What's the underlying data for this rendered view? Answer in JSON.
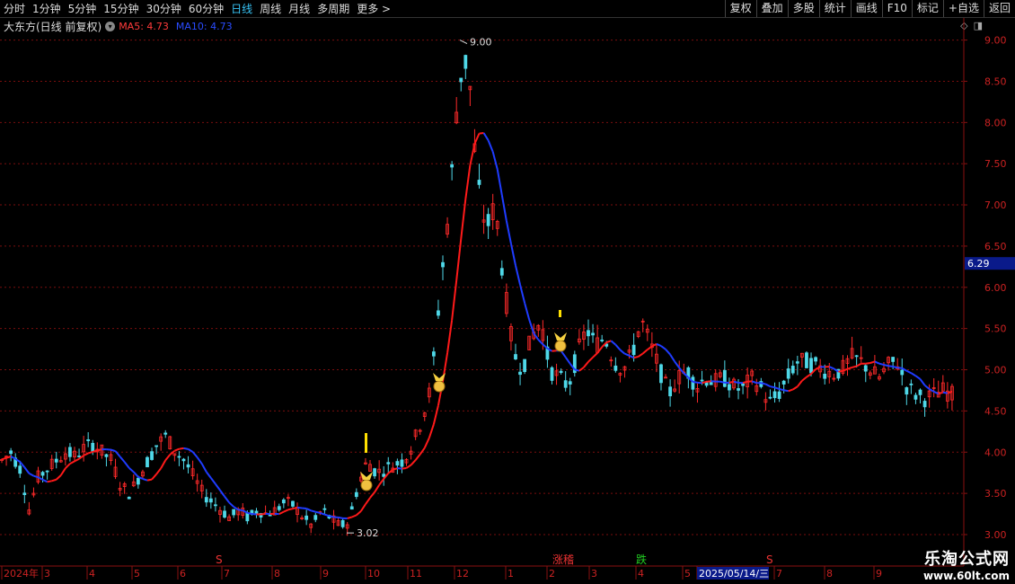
{
  "toolbar": {
    "left": [
      "分时",
      "1分钟",
      "5分钟",
      "15分钟",
      "30分钟",
      "60分钟",
      "日线",
      "周线",
      "月线",
      "多周期",
      "更多 >"
    ],
    "active_index": 6,
    "right": [
      "复权",
      "叠加",
      "多股",
      "统计",
      "画线",
      "F10",
      "标记",
      "+自选",
      "返回"
    ]
  },
  "title": {
    "stock": "大东方(日线 前复权)",
    "ma5": "MA5: 4.73",
    "ma10": "MA10: 4.73"
  },
  "price_label": "6.29",
  "watermark": {
    "line1": "乐淘公式网",
    "line2": "www.60lt.com"
  },
  "bottom_badges": [
    "S",
    "涨稽",
    "跌",
    "S"
  ],
  "chart_data": {
    "type": "candlestick",
    "ylim": [
      3.0,
      9.05
    ],
    "yticks": [
      "9.00",
      "8.50",
      "8.00",
      "7.50",
      "7.00",
      "6.50",
      "6.00",
      "5.50",
      "5.00",
      "4.50",
      "4.00",
      "3.50",
      "3.00"
    ],
    "xaxis_labels": [
      "2024年",
      "3",
      "4",
      "5",
      "6",
      "7",
      "8",
      "9",
      "10",
      "11",
      "12",
      "1",
      "2",
      "3",
      "4",
      "5",
      "2025/05/14/三",
      "7",
      "8",
      "9"
    ],
    "current_price": 6.29,
    "annotations": [
      {
        "text": "9.00",
        "value": 9.0
      },
      {
        "text": "3.02",
        "value": 3.02
      }
    ],
    "close_path": [
      3.9,
      4.0,
      3.8,
      3.3,
      3.7,
      3.8,
      3.9,
      4.0,
      3.95,
      4.05,
      4.1,
      4.0,
      3.9,
      3.6,
      3.5,
      3.7,
      3.9,
      4.1,
      4.2,
      4.0,
      3.9,
      3.7,
      3.5,
      3.4,
      3.3,
      3.2,
      3.3,
      3.2,
      3.3,
      3.25,
      3.3,
      3.4,
      3.35,
      3.2,
      3.1,
      3.3,
      3.2,
      3.1,
      3.15,
      3.6,
      3.9,
      3.75,
      3.8,
      3.85,
      3.9,
      4.1,
      4.4,
      4.8,
      6.0,
      7.0,
      8.5,
      8.8,
      7.3,
      6.7,
      7.0,
      6.0,
      5.2,
      5.0,
      5.4,
      5.6,
      5.0,
      4.9,
      4.8,
      5.2,
      5.5,
      5.3,
      5.4,
      5.1,
      5.0,
      5.2,
      5.6,
      5.3,
      5.0,
      4.7,
      4.9,
      5.0,
      4.8,
      4.9,
      4.85,
      4.9,
      4.8,
      4.75,
      4.9,
      4.8,
      4.6,
      4.7,
      4.9,
      5.1,
      5.1,
      5.05,
      5.0,
      4.95,
      5.0,
      5.15,
      5.1,
      5.0,
      4.9,
      5.05,
      5.1,
      4.8,
      4.7,
      4.65,
      4.7,
      4.75,
      4.7
    ]
  }
}
